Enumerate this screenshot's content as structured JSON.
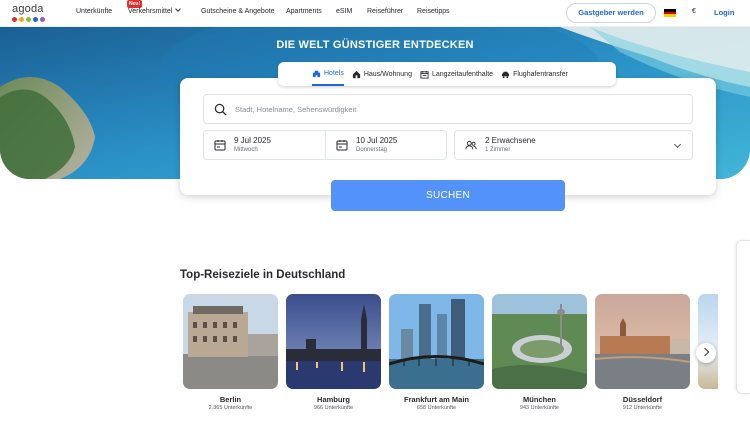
{
  "brand": {
    "logo_text": "agoda",
    "logo_dot_colors": [
      "#e12d2d",
      "#f5a623",
      "#7cc242",
      "#2067da",
      "#9b59b6"
    ]
  },
  "nav": {
    "items": [
      {
        "label": "Unterkünfte"
      },
      {
        "label": "Verkehrsmittel",
        "badge": "Neu!"
      },
      {
        "label": "Gutscheine & Angebote"
      },
      {
        "label": "Apartments"
      },
      {
        "label": "eSIM"
      },
      {
        "label": "Reiseführer"
      },
      {
        "label": "Reisetipps"
      }
    ],
    "host_button": "Gastgeber werden",
    "currency": "€",
    "login": "Login",
    "language_flag": "germany-flag-icon"
  },
  "hero": {
    "title": "DIE WELT GÜNSTIGER ENTDECKEN"
  },
  "tabs": [
    {
      "label": "Hotels",
      "icon": "hotel-icon",
      "active": true
    },
    {
      "label": "Haus/Wohnung",
      "icon": "home-icon",
      "active": false
    },
    {
      "label": "Langzeitaufenthalte",
      "icon": "calendar-icon",
      "active": false
    },
    {
      "label": "Flughafentransfer",
      "icon": "car-icon",
      "active": false
    }
  ],
  "search": {
    "placeholder": "Stadt, Hotelname, Sehenswürdigkeit",
    "checkin": {
      "date": "9 Jul 2025",
      "weekday": "Mittwoch"
    },
    "checkout": {
      "date": "10 Jul 2025",
      "weekday": "Donnerstag"
    },
    "guests": {
      "adults": "2 Erwachsene",
      "rooms": "1 Zimmer"
    },
    "button": "SUCHEN"
  },
  "destinations": {
    "title": "Top-Reiseziele in Deutschland",
    "cards": [
      {
        "city": "Berlin",
        "count": "2.365 Unterkünfte"
      },
      {
        "city": "Hamburg",
        "count": "966 Unterkünfte"
      },
      {
        "city": "Frankfurt am Main",
        "count": "658 Unterkünfte"
      },
      {
        "city": "München",
        "count": "943 Unterkünfte"
      },
      {
        "city": "Düsseldorf",
        "count": "912 Unterkünfte"
      }
    ]
  },
  "colors": {
    "accent": "#2067da",
    "search_button": "#5392f9",
    "new_badge": "#e12d2d"
  }
}
